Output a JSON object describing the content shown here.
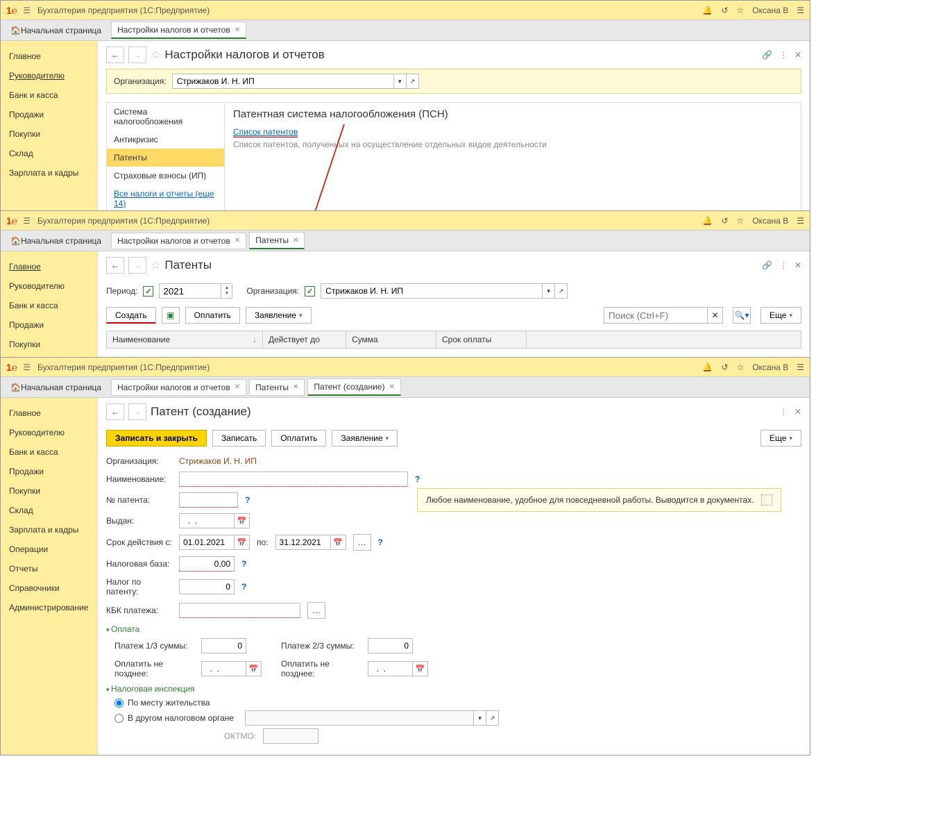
{
  "app": {
    "title": "Бухгалтерия предприятия  (1С:Предприятие)",
    "user": "Оксана В"
  },
  "tabs": {
    "home": "Начальная страница",
    "settings": "Настройки налогов и отчетов",
    "patents": "Патенты",
    "patent_create": "Патент (создание)"
  },
  "sidebar_full": [
    "Главное",
    "Руководителю",
    "Банк и касса",
    "Продажи",
    "Покупки",
    "Склад",
    "Зарплата и кадры",
    "Операции",
    "Отчеты",
    "Справочники",
    "Администрирование"
  ],
  "win1": {
    "title": "Настройки налогов и отчетов",
    "org_label": "Организация:",
    "org_value": "Стрижаков И. Н. ИП",
    "nav": {
      "items": [
        "Система налогообложения",
        "Антикризис",
        "Патенты",
        "Страховые взносы (ИП)"
      ],
      "link": "Все налоги и отчеты (еще 14)"
    },
    "detail": {
      "title": "Патентная система налогообложения (ПСН)",
      "link": "Список патентов",
      "hint": "Список патентов, полученных на осуществление отдельных видов деятельности"
    }
  },
  "win2": {
    "title": "Патенты",
    "period_label": "Период:",
    "period_value": "2021",
    "org_label": "Организация:",
    "org_value": "Стрижаков И. Н. ИП",
    "buttons": {
      "create": "Создать",
      "pay": "Оплатить",
      "statement": "Заявление",
      "more": "Еще"
    },
    "search_placeholder": "Поиск (Ctrl+F)",
    "columns": [
      "Наименование",
      "Действует до",
      "Сумма",
      "Срок оплаты"
    ]
  },
  "win3": {
    "title": "Патент (создание)",
    "buttons": {
      "save_close": "Записать и закрыть",
      "save": "Записать",
      "pay": "Оплатить",
      "statement": "Заявление",
      "more": "Еще"
    },
    "fields": {
      "org_label": "Организация:",
      "org_value": "Стрижаков И. Н. ИП",
      "name_label": "Наименование:",
      "num_label": "№ патента:",
      "issued_label": "Выдан:",
      "issued_value": "  .  .",
      "valid_from_label": "Срок действия с:",
      "valid_from": "01.01.2021",
      "to_label": "по:",
      "valid_to": "31.12.2021",
      "base_label": "Налоговая база:",
      "base_value": "0,00",
      "tax_label": "Налог по патенту:",
      "tax_value": "0",
      "kbk_label": "КБК платежа:"
    },
    "payment": {
      "head": "Оплата",
      "p13_label": "Платеж 1/3 суммы:",
      "p13_value": "0",
      "p23_label": "Платеж 2/3 суммы:",
      "p23_value": "0",
      "due1_label": "Оплатить не позднее:",
      "due1_value": "  .  .",
      "due2_label": "Оплатить не позднее:",
      "due2_value": "  .  ."
    },
    "tax_office": {
      "head": "Налоговая инспекция",
      "opt1": "По месту жительства",
      "opt2": "В другом налоговом органе",
      "oktmo_label": "ОКТМО:"
    },
    "tooltip": "Любое наименование, удобное для повседневной работы. Выводится в документах."
  }
}
